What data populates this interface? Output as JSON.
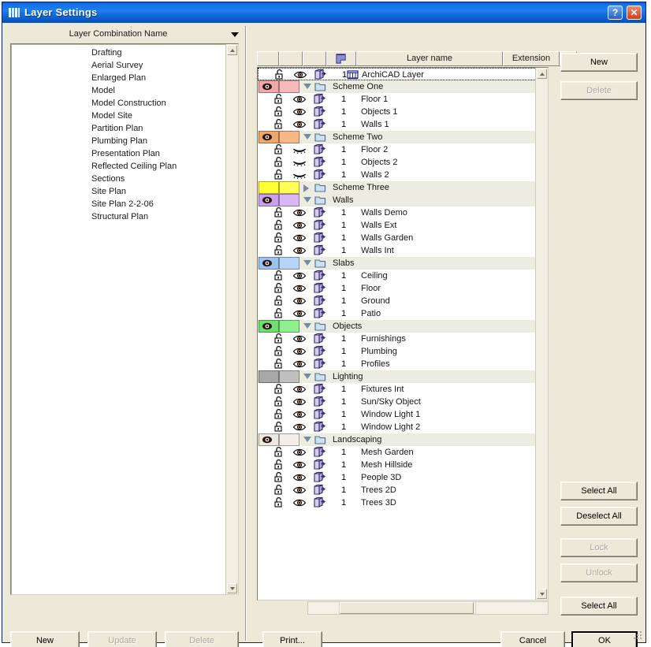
{
  "window": {
    "title": "Layer Settings",
    "icon": "layers-icon",
    "help_button": "?",
    "close_button": "✕"
  },
  "left_panel": {
    "header_label": "Layer Combination Name",
    "dropdown_icon": "chevron-down-icon",
    "items": [
      "Drafting",
      "Aerial Survey",
      "Enlarged Plan",
      "Model",
      "Model Construction",
      "Model Site",
      "Partition Plan",
      "Plumbing Plan",
      "Presentation Plan",
      "Reflected Ceiling Plan",
      "Sections",
      "Site Plan",
      "Site Plan 2-2-06",
      "Structural Plan"
    ],
    "buttons": [
      {
        "label": "New",
        "enabled": true
      },
      {
        "label": "Update",
        "enabled": false
      },
      {
        "label": "Delete",
        "enabled": false
      }
    ]
  },
  "layer_list": {
    "columns": [
      {
        "label": "",
        "icon": "lock-column-icon"
      },
      {
        "label": "",
        "icon": "eye-column-icon"
      },
      {
        "label": "",
        "icon": "solid-wireframe-column-icon"
      },
      {
        "label": "",
        "icon": "pen-hatch-icon"
      },
      {
        "label": "Layer name",
        "icon": ""
      },
      {
        "label": "Extension",
        "icon": ""
      },
      {
        "label": "",
        "icon": "filter-funnel-icon"
      }
    ],
    "rows": [
      {
        "type": "layer",
        "name": "ArchiCAD Layer",
        "num": "1",
        "locked": false,
        "visible": true,
        "selected": true,
        "has_special_icon": true
      },
      {
        "type": "group",
        "name": "Scheme One",
        "color_a": "#f0a9a9",
        "color_b": "#f7b9b9",
        "expanded": true,
        "eye": true
      },
      {
        "type": "layer",
        "name": "Floor 1",
        "num": "1",
        "locked": false,
        "visible": true
      },
      {
        "type": "layer",
        "name": "Objects 1",
        "num": "1",
        "locked": false,
        "visible": true
      },
      {
        "type": "layer",
        "name": "Walls 1",
        "num": "1",
        "locked": false,
        "visible": true
      },
      {
        "type": "group",
        "name": "Scheme Two",
        "color_a": "#f0a76a",
        "color_b": "#f7b787",
        "expanded": true,
        "eye": true
      },
      {
        "type": "layer",
        "name": "Floor 2",
        "num": "1",
        "locked": false,
        "visible": false
      },
      {
        "type": "layer",
        "name": "Objects 2",
        "num": "1",
        "locked": false,
        "visible": false
      },
      {
        "type": "layer",
        "name": "Walls 2",
        "num": "1",
        "locked": false,
        "visible": false
      },
      {
        "type": "group",
        "name": "Scheme Three",
        "color_a": "#ffff33",
        "color_b": "#ffff55",
        "expanded": false,
        "eye": false
      },
      {
        "type": "group",
        "name": "Walls",
        "color_a": "#c9a0f0",
        "color_b": "#d8b6f7",
        "expanded": true,
        "eye": true
      },
      {
        "type": "layer",
        "name": "Walls Demo",
        "num": "1",
        "locked": false,
        "visible": true
      },
      {
        "type": "layer",
        "name": "Walls Ext",
        "num": "1",
        "locked": false,
        "visible": true
      },
      {
        "type": "layer",
        "name": "Walls Garden",
        "num": "1",
        "locked": false,
        "visible": true
      },
      {
        "type": "layer",
        "name": "Walls Int",
        "num": "1",
        "locked": false,
        "visible": true
      },
      {
        "type": "group",
        "name": "Slabs",
        "color_a": "#9cc3f0",
        "color_b": "#b7d4f7",
        "expanded": true,
        "eye": true
      },
      {
        "type": "layer",
        "name": "Ceiling",
        "num": "1",
        "locked": false,
        "visible": true
      },
      {
        "type": "layer",
        "name": "Floor",
        "num": "1",
        "locked": false,
        "visible": true
      },
      {
        "type": "layer",
        "name": "Ground",
        "num": "1",
        "locked": false,
        "visible": true
      },
      {
        "type": "layer",
        "name": "Patio",
        "num": "1",
        "locked": false,
        "visible": true
      },
      {
        "type": "group",
        "name": "Objects",
        "color_a": "#6ee06e",
        "color_b": "#8df28d",
        "expanded": true,
        "eye": true
      },
      {
        "type": "layer",
        "name": "Furnishings",
        "num": "1",
        "locked": false,
        "visible": true
      },
      {
        "type": "layer",
        "name": "Plumbing",
        "num": "1",
        "locked": false,
        "visible": true
      },
      {
        "type": "layer",
        "name": "Profiles",
        "num": "1",
        "locked": false,
        "visible": true
      },
      {
        "type": "group",
        "name": "Lighting",
        "color_a": "#a8a8a8",
        "color_b": "#c0c0c0",
        "expanded": true,
        "eye": false
      },
      {
        "type": "layer",
        "name": "Fixtures Int",
        "num": "1",
        "locked": false,
        "visible": true
      },
      {
        "type": "layer",
        "name": "Sun/Sky Object",
        "num": "1",
        "locked": false,
        "visible": true
      },
      {
        "type": "layer",
        "name": "Window Light 1",
        "num": "1",
        "locked": false,
        "visible": true
      },
      {
        "type": "layer",
        "name": "Window Light 2",
        "num": "1",
        "locked": false,
        "visible": true
      },
      {
        "type": "group",
        "name": "Landscaping",
        "color_a": "#eceade",
        "color_b": "#f2f0e6",
        "expanded": true,
        "eye": true
      },
      {
        "type": "layer",
        "name": "Mesh Garden",
        "num": "1",
        "locked": false,
        "visible": true
      },
      {
        "type": "layer",
        "name": "Mesh Hillside",
        "num": "1",
        "locked": false,
        "visible": true
      },
      {
        "type": "layer",
        "name": "People 3D",
        "num": "1",
        "locked": false,
        "visible": true
      },
      {
        "type": "layer",
        "name": "Trees 2D",
        "num": "1",
        "locked": false,
        "visible": true
      },
      {
        "type": "layer",
        "name": "Trees 3D",
        "num": "1",
        "locked": false,
        "visible": true
      }
    ]
  },
  "right_buttons": [
    {
      "label": "New",
      "enabled": true
    },
    {
      "label": "Delete",
      "enabled": false
    },
    {
      "label": "Select All",
      "enabled": true
    },
    {
      "label": "Deselect All",
      "enabled": true
    },
    {
      "label": "Lock",
      "enabled": false
    },
    {
      "label": "Unlock",
      "enabled": false
    },
    {
      "label": "Select All",
      "enabled": true
    }
  ],
  "footer": {
    "print_label": "Print...",
    "cancel_label": "Cancel",
    "ok_label": "OK"
  },
  "colors": {
    "titlebar": "#1270e8",
    "dialog_face": "#ece9d8",
    "group_row": "#edece0",
    "list_background": "#ffffff"
  }
}
